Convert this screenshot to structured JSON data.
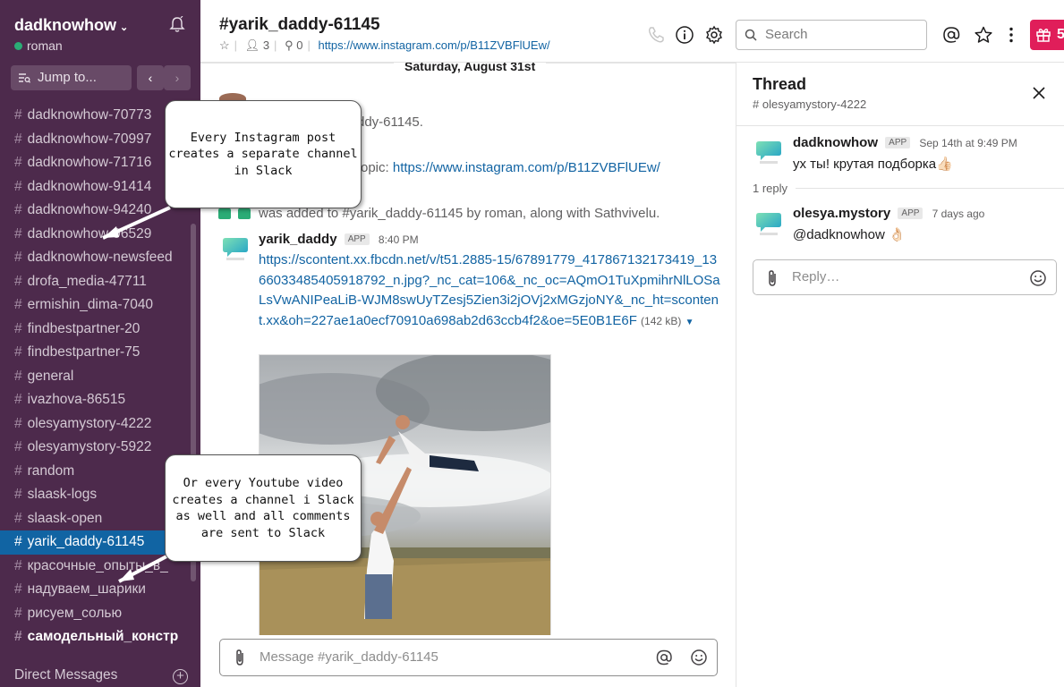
{
  "workspace": {
    "name": "dadknowhow",
    "user": "roman"
  },
  "sidebar": {
    "jump_label": "Jump to...",
    "channels": [
      {
        "label": "dadknowhow-70773",
        "state": "normal"
      },
      {
        "label": "dadknowhow-70997",
        "state": "normal"
      },
      {
        "label": "dadknowhow-71716",
        "state": "normal"
      },
      {
        "label": "dadknowhow-91414",
        "state": "normal"
      },
      {
        "label": "dadknowhow-94240",
        "state": "normal"
      },
      {
        "label": "dadknowhow-96529",
        "state": "normal"
      },
      {
        "label": "dadknowhow-newsfeed",
        "state": "normal"
      },
      {
        "label": "drofa_media-47711",
        "state": "normal"
      },
      {
        "label": "ermishin_dima-7040",
        "state": "normal"
      },
      {
        "label": "findbestpartner-20",
        "state": "normal"
      },
      {
        "label": "findbestpartner-75",
        "state": "normal"
      },
      {
        "label": "general",
        "state": "normal"
      },
      {
        "label": "ivazhova-86515",
        "state": "normal"
      },
      {
        "label": "olesyamystory-4222",
        "state": "normal"
      },
      {
        "label": "olesyamystory-5922",
        "state": "normal"
      },
      {
        "label": "random",
        "state": "normal"
      },
      {
        "label": "slaask-logs",
        "state": "normal"
      },
      {
        "label": "slaask-open",
        "state": "normal"
      },
      {
        "label": "yarik_daddy-61145",
        "state": "active"
      },
      {
        "label": "красочные_опыты_в_",
        "state": "normal"
      },
      {
        "label": "надуваем_шарики",
        "state": "normal"
      },
      {
        "label": "рисуем_солью",
        "state": "normal"
      },
      {
        "label": "самодельный_констр",
        "state": "bold"
      }
    ],
    "direct_messages_label": "Direct Messages"
  },
  "header": {
    "channel": "#yarik_daddy-61145",
    "members": "3",
    "pins": "0",
    "topic_link": "https://www.instagram.com/p/B11ZVBFlUEw/",
    "search_placeholder": "Search",
    "gift_count": "5"
  },
  "messages": {
    "date_divider": "Saturday, August 31st",
    "sys_join_tail": "ddy-61145.",
    "sys_topic_prefix": "opic: ",
    "sys_topic_link": "https://www.instagram.com/p/B11ZVBFlUEw/",
    "sys_added": "was added to #yarik_daddy-61145 by roman, along with Sathvivelu.",
    "author": "yarik_daddy",
    "app_badge": "APP",
    "time": "8:40 PM",
    "link": "https://scontent.xx.fbcdn.net/v/t51.2885-15/67891779_417867132173419_1366033485405918792_n.jpg?_nc_cat=106&_nc_oc=AQmO1TuXpmihrNlLOSaLsVwANIPeaLiB-WJM8swUyTZesj5Zien3i2jOVj2xMGzjoNY&_nc_ht=scontent.xx&oh=227ae1a0ecf70910a698ab2d63ccb4f2&oe=5E0B1E6F",
    "file_size": "(142 kB)",
    "composer_placeholder": "Message #yarik_daddy-61145"
  },
  "thread": {
    "title": "Thread",
    "channel": "# olesyamystory-4222",
    "parent": {
      "author": "dadknowhow",
      "badge": "APP",
      "time": "Sep 14th at 9:49 PM",
      "text": "ух ты! крутая подборка👍🏻"
    },
    "reply_count": "1 reply",
    "reply": {
      "author": "olesya.mystory",
      "badge": "APP",
      "time": "7 days ago",
      "text": "@dadknowhow 👌🏻"
    },
    "reply_placeholder": "Reply…"
  },
  "annotations": {
    "note1": "Every Instagram post creates a separate channel in Slack",
    "note2": "Or every Youtube video creates a channel i Slack as well and all comments are sent to Slack"
  },
  "colors": {
    "sidebar": "#4d2a4c",
    "active": "#1164a3",
    "link": "#1264a3",
    "gift": "#e01e5a",
    "online": "#2bac76"
  }
}
